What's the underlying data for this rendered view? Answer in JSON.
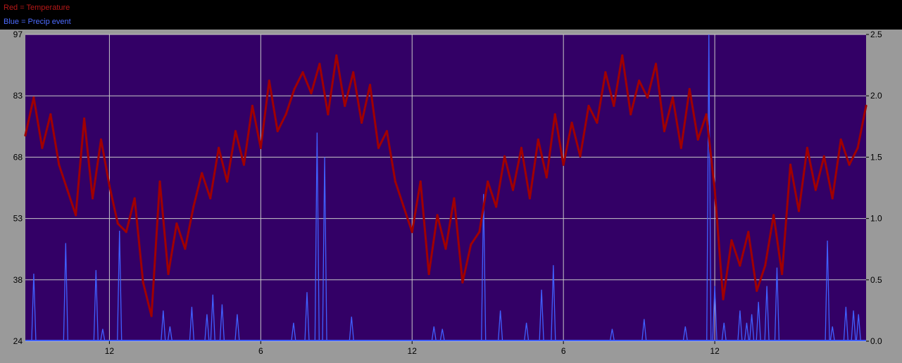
{
  "legend": {
    "red_label": "Red = Temperature",
    "blue_label": "Blue = Precip event"
  },
  "colors": {
    "background": "#000000",
    "frame": "#9a9a9a",
    "plot_area": "#330066",
    "grid": "#c8c8c8",
    "temperature": "#a00000",
    "precip": "#4060ff"
  },
  "chart_data": {
    "type": "line",
    "title": "",
    "xlabel": "",
    "ylabel": "",
    "grid": true,
    "x_ticks": [
      "12",
      "6",
      "12",
      "6",
      "12"
    ],
    "x_tick_positions": [
      12,
      30,
      48,
      66,
      84
    ],
    "xlim": [
      2,
      102
    ],
    "y_left": {
      "ticks": [
        "97",
        "83",
        "68",
        "53",
        "38",
        "24"
      ],
      "range": [
        24,
        97
      ]
    },
    "y_right": {
      "ticks": [
        "2.5",
        "2.0",
        "1.5",
        "1.0",
        "0.5",
        "0.0"
      ],
      "range": [
        0.0,
        2.5
      ]
    },
    "series": [
      {
        "name": "Temperature",
        "axis": "left",
        "x": [
          2,
          3,
          4,
          5,
          6,
          7,
          8,
          9,
          10,
          11,
          12,
          13,
          14,
          15,
          16,
          17,
          18,
          19,
          20,
          21,
          22,
          23,
          24,
          25,
          26,
          27,
          28,
          29,
          30,
          31,
          32,
          33,
          34,
          35,
          36,
          37,
          38,
          39,
          40,
          41,
          42,
          43,
          44,
          45,
          46,
          47,
          48,
          49,
          50,
          51,
          52,
          53,
          54,
          55,
          56,
          57,
          58,
          59,
          60,
          61,
          62,
          63,
          64,
          65,
          66,
          67,
          68,
          69,
          70,
          71,
          72,
          73,
          74,
          75,
          76,
          77,
          78,
          79,
          80,
          81,
          82,
          83,
          84,
          85,
          86,
          87,
          88,
          89,
          90,
          91,
          92,
          93,
          94,
          95,
          96,
          97,
          98,
          99,
          100,
          101,
          102
        ],
        "values": [
          73,
          82,
          70,
          78,
          66,
          60,
          54,
          77,
          58,
          72,
          61,
          52,
          50,
          58,
          38,
          30,
          62,
          40,
          52,
          46,
          56,
          64,
          58,
          70,
          62,
          74,
          66,
          80,
          70,
          86,
          74,
          78,
          84,
          88,
          83,
          90,
          78,
          92,
          80,
          88,
          76,
          85,
          70,
          74,
          62,
          56,
          50,
          62,
          40,
          54,
          46,
          58,
          38,
          47,
          50,
          62,
          56,
          68,
          60,
          70,
          58,
          72,
          63,
          78,
          66,
          76,
          68,
          80,
          76,
          88,
          80,
          92,
          78,
          86,
          82,
          90,
          74,
          82,
          70,
          84,
          72,
          78,
          60,
          34,
          48,
          42,
          50,
          36,
          42,
          54,
          40,
          66,
          55,
          70,
          60,
          68,
          58,
          72,
          66,
          70,
          80
        ]
      },
      {
        "name": "Precip event",
        "axis": "right",
        "x": [
          3,
          6.8,
          10.4,
          11.2,
          13.2,
          18.4,
          19.2,
          21.8,
          23.6,
          24.3,
          25.4,
          27.2,
          33.9,
          35.5,
          36.7,
          37.6,
          40.8,
          50.6,
          51.6,
          56.5,
          58.5,
          61.6,
          63.4,
          64.8,
          71.8,
          75.6,
          80.5,
          83.3,
          84.0,
          85.1,
          87.0,
          87.8,
          88.4,
          89.2,
          90.2,
          91.4,
          97.4,
          98.0,
          99.6,
          100.5,
          101.1
        ],
        "values": [
          0.55,
          0.8,
          0.58,
          0.1,
          0.9,
          0.25,
          0.12,
          0.28,
          0.22,
          0.38,
          0.3,
          0.22,
          0.15,
          0.4,
          1.7,
          1.5,
          0.2,
          0.12,
          0.1,
          1.2,
          0.25,
          0.15,
          0.42,
          0.62,
          0.1,
          0.18,
          0.12,
          2.5,
          0.45,
          0.15,
          0.25,
          0.15,
          0.22,
          0.32,
          0.45,
          0.6,
          0.82,
          0.12,
          0.28,
          0.25,
          0.22
        ]
      }
    ]
  }
}
